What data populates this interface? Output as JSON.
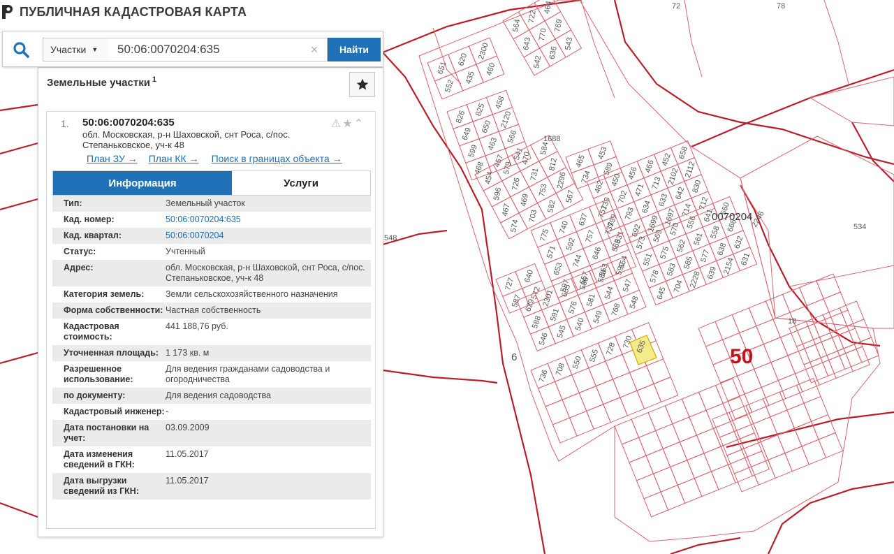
{
  "header": {
    "title": "ПУБЛИЧНАЯ КАДАСТРОВАЯ КАРТА",
    "logo_icon": "pkk-logo-icon"
  },
  "search": {
    "type_label": "Участки",
    "query": "50:06:0070204:635",
    "find_label": "Найти",
    "clear_glyph": "×"
  },
  "panel": {
    "title": "Земельные участки",
    "count": "1",
    "item": {
      "num": "1.",
      "cad_number": "50:06:0070204:635",
      "address": "обл. Московская, р-н Шаховской, снт Роса, с/пос. Степаньковское, уч-к 48"
    },
    "links": [
      "План ЗУ →",
      "План КК →",
      "Поиск в границах объекта →"
    ],
    "tabs": [
      "Информация",
      "Услуги"
    ],
    "rows": [
      {
        "key": "Тип:",
        "value": "Земельный участок"
      },
      {
        "key": "Кад. номер:",
        "value": "50:06:0070204:635"
      },
      {
        "key": "Кад. квартал:",
        "value": "50:06:0070204"
      },
      {
        "key": "Статус:",
        "value": "Учтенный"
      },
      {
        "key": "Адрес:",
        "value": "обл. Московская, р-н Шаховской, снт Роса, с/пос. Степаньковское, уч-к 48"
      },
      {
        "key": "Категория земель:",
        "value": "Земли сельскохозяйственного назначения"
      },
      {
        "key": "Форма собственности:",
        "value": "Частная собственность"
      },
      {
        "key": "Кадастровая стоимость:",
        "value": "441 188,76 руб."
      },
      {
        "key": "Уточненная площадь:",
        "value": "1 173 кв. м"
      },
      {
        "key": "Разрешенное использование:",
        "value": "Для ведения гражданами садоводства и огородничества"
      },
      {
        "key": "по документу:",
        "value": "Для ведения садоводства"
      },
      {
        "key": "Кадастровый инженер:",
        "value": "-"
      },
      {
        "key": "Дата постановки на учет:",
        "value": "03.09.2009"
      },
      {
        "key": "Дата изменения сведений в ГКН:",
        "value": "11.05.2017"
      },
      {
        "key": "Дата выгрузки сведений из ГКН:",
        "value": "11.05.2017"
      }
    ]
  },
  "map": {
    "quarter_label": "0070204",
    "district_label": "50",
    "selected_label": "635",
    "outer_labels": [
      "72",
      "78",
      "1688",
      "534",
      "548",
      "18",
      "6",
      "2246"
    ],
    "plot_labels": [
      "651",
      "620",
      "2300",
      "552",
      "435",
      "460",
      "564",
      "722",
      "464",
      "643",
      "770",
      "769",
      "542",
      "636",
      "543",
      "826",
      "825",
      "458",
      "649",
      "650",
      "2120",
      "599",
      "463",
      "566",
      "468",
      "457",
      "541",
      "465",
      "453",
      "734",
      "589",
      "454",
      "579",
      "470",
      "584",
      "596",
      "726",
      "731",
      "812",
      "467",
      "469",
      "753",
      "2296",
      "574",
      "703",
      "582",
      "567",
      "462",
      "450",
      "456",
      "466",
      "452",
      "658",
      "730",
      "702",
      "471",
      "713",
      "2102",
      "2112",
      "799",
      "793",
      "634",
      "633",
      "642",
      "830",
      "831",
      "692",
      "1699",
      "1697",
      "714",
      "712",
      "775",
      "740",
      "637",
      "751",
      "571",
      "592",
      "757",
      "735",
      "653",
      "744",
      "646",
      "565",
      "597",
      "557",
      "563",
      "554",
      "573",
      "569",
      "570",
      "556",
      "641",
      "560",
      "551",
      "575",
      "562",
      "561",
      "558",
      "668",
      "578",
      "583",
      "585",
      "577",
      "638",
      "632",
      "645",
      "704",
      "2228",
      "639",
      "2154",
      "631",
      "727",
      "640",
      "587",
      "572",
      "629",
      "2301",
      "605",
      "586",
      "580",
      "590",
      "588",
      "591",
      "576",
      "581",
      "544",
      "547",
      "546",
      "545",
      "540",
      "549",
      "768",
      "548",
      "736",
      "708",
      "550",
      "555",
      "728",
      "730"
    ]
  },
  "colors": {
    "accent": "#1f72b8",
    "parcel_line": "#d9646b",
    "boundary": "#b81e2a",
    "selected_fill": "#f4ec8c"
  }
}
